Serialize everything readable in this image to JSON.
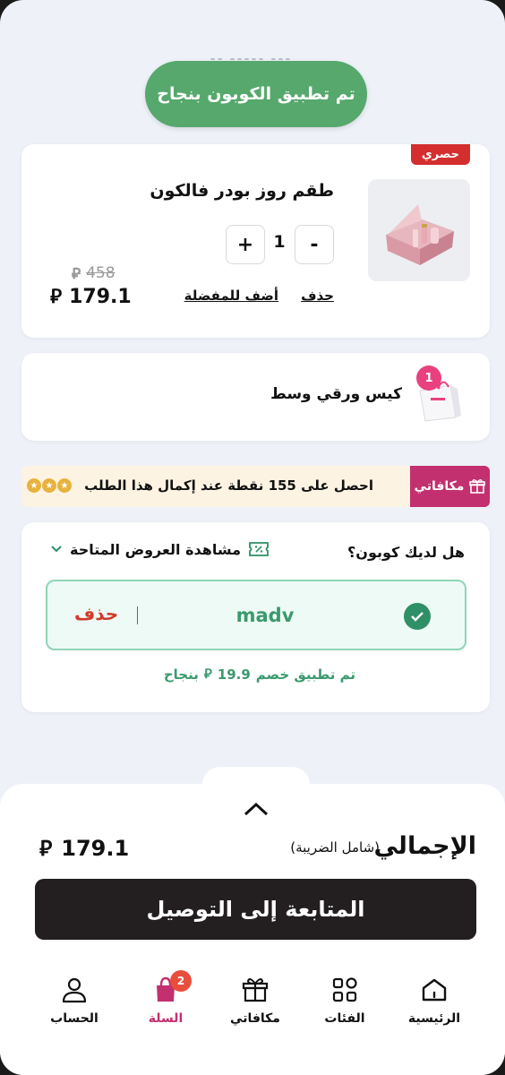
{
  "toast": {
    "text": "تم تطبيق الكوبون بنجاح"
  },
  "currency_symbol": "⃁",
  "product": {
    "badge": "حصري",
    "name": "طقم روز بودر فالكون",
    "quantity": "1",
    "minus_label": "-",
    "plus_label": "+",
    "delete_label": "حذف",
    "favorite_label": "أضف للمفضلة",
    "old_price": "458",
    "new_price": "179.1"
  },
  "bag": {
    "count": "1",
    "label": "كيس ورقي وسط"
  },
  "rewards": {
    "tab_label": "مكافاتي",
    "text": "احصل على 155 نقطة عند إكمال هذا الطلب"
  },
  "coupon": {
    "question": "هل لديك كوبون؟",
    "offers_label": "مشاهدة العروض المتاحة",
    "code": "madv",
    "delete_label": "حذف",
    "applied_prefix": "تم تطبيق خصم",
    "applied_amount": "19.9",
    "applied_suffix": "بنجاح"
  },
  "summary": {
    "total_label": "الإجمالي",
    "total_note": "(شامل الضريبة)",
    "total_value": "179.1",
    "checkout_label": "المتابعة إلى التوصيل"
  },
  "nav": {
    "home": "الرئيسية",
    "categories": "الفئات",
    "rewards": "مكافاتي",
    "cart": "السلة",
    "cart_badge": "2",
    "account": "الحساب"
  },
  "colors": {
    "toast_green": "#56a86c",
    "accent_pink": "#c2306f",
    "exclusive_red": "#d42e2e",
    "coupon_green": "#3a9a6e",
    "delete_red": "#d23a2a",
    "checkout_dark": "#231f20"
  }
}
